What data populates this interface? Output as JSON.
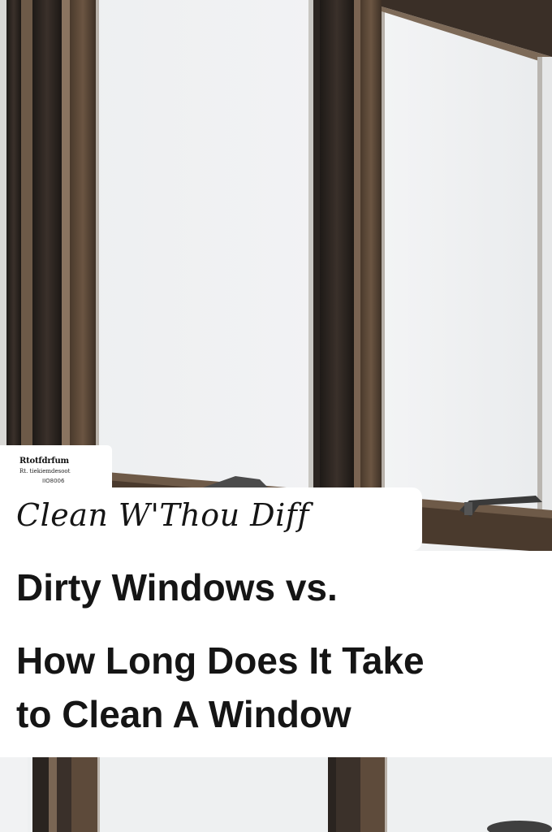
{
  "logo": {
    "line1": "Rtotfdrfum",
    "line2": "Rt.  tiekiemdesoot",
    "line3": "IIO8006"
  },
  "subtitle": "Clean W'Thou Diff",
  "title": {
    "line1": "Dirty Windows vs.",
    "line2": "How Long Does It Take",
    "line3": "to Clean A Window"
  },
  "colors": {
    "frame_dark": "#2b2520",
    "frame_brown": "#5a4634",
    "glass": "#f2f3f4",
    "text": "#151515"
  }
}
